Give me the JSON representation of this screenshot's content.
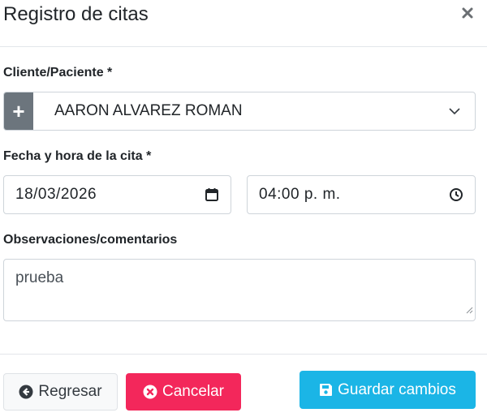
{
  "modal": {
    "title": "Registro de citas",
    "close_icon": "times-icon"
  },
  "form": {
    "client_label": "Cliente/Paciente *",
    "client_value": "AARON ALVAREZ ROMAN",
    "add_icon": "plus-icon",
    "datetime_label": "Fecha y hora de la cita *",
    "date_value": "18/03/2026",
    "time_value": "04:00 p. m.",
    "notes_label": "Observaciones/comentarios",
    "notes_value": "prueba"
  },
  "footer": {
    "back_label": "Regresar",
    "cancel_label": "Cancelar",
    "save_label": "Guardar cambios"
  },
  "colors": {
    "cancel": "#f3275b",
    "save": "#1bb5e6",
    "add_button": "#6c757d"
  }
}
